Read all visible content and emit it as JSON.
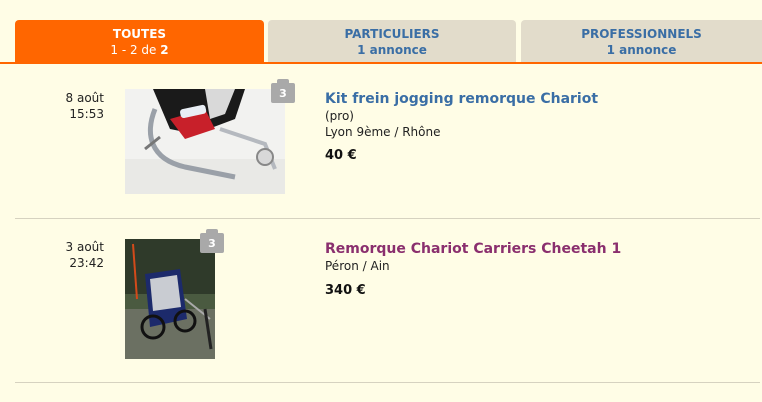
{
  "tabs": [
    {
      "title": "TOUTES",
      "sub_range": "1 - 2 de ",
      "sub_count": "2"
    },
    {
      "title": "PARTICULIERS",
      "sub": "1 annonce"
    },
    {
      "title": "PROFESSIONNELS",
      "sub": "1 annonce"
    }
  ],
  "listings": [
    {
      "day": "8 août",
      "time": "15:53",
      "photo_count": "3",
      "title": "Kit frein jogging remorque Chariot",
      "seller_type": "(pro)",
      "location": "Lyon 9ème / Rhône",
      "price": "40 €"
    },
    {
      "day": "3 août",
      "time": "23:42",
      "photo_count": "3",
      "title": "Remorque Chariot Carriers Cheetah 1",
      "location": "Péron / Ain",
      "price": "340 €"
    }
  ],
  "colors": {
    "accent": "#ff6600",
    "link_blue": "#3a6ea5",
    "link_visited": "#8a2f6e",
    "background": "#fffde6"
  }
}
